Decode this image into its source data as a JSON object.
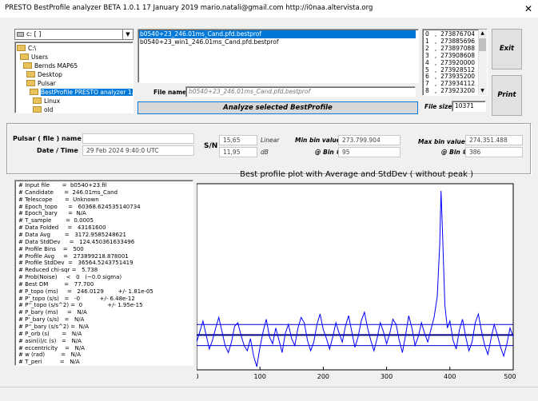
{
  "window": {
    "title": "PRESTO BestProfile analyzer BETA 1.0.1   17 January 2019       mario.natali@gmail.com      http://i0naa.altervista.org",
    "close_glyph": "✕"
  },
  "drive": {
    "value": "c: [ ]"
  },
  "dir_tree": [
    "C:\\",
    "Users",
    "Bernds MAP65",
    "Desktop",
    "Pulsar",
    "BestProfile PRESTO analyzer 1.0",
    "Linux",
    "old",
    "..."
  ],
  "dir_selected_index": 5,
  "files": [
    "b0540+23_246.01ms_Cand.pfd.bestprof",
    "b0540+23_win1_246.01ms_Cand.pfd.bestprof"
  ],
  "file_selected_index": 0,
  "file_name": {
    "label": "File name",
    "value": "b0540+23_246.01ms_Cand.pfd.bestprof"
  },
  "analyze_button": "Analyze selected BestProfile",
  "values_list": [
    "0   ,  273876704",
    "1   ,  273885696",
    "2   ,  273897088",
    "3   ,  273908608",
    "4   ,  273920000",
    "5   ,  273928512",
    "6   ,  273935200",
    "7   ,  273934112",
    "8   ,  273923200",
    "9   ,  273900192"
  ],
  "exit_button": "Exit",
  "print_button": "Print",
  "file_size": {
    "label": "File size",
    "value": "10371"
  },
  "info": {
    "pulsar_label": "Pulsar ( file ) name",
    "pulsar_value": "",
    "date_label": "Date / Time",
    "date_value": "29 Feb 2024      9:40:0  UTC",
    "sn_label": "S/N",
    "sn_linear": "15,65",
    "sn_linear_unit": "Linear",
    "sn_db": "11,95",
    "sn_db_unit": "dB",
    "min_bin_label": "Min bin value",
    "min_bin_value": "273.799.904",
    "min_bin_at_label": "@ Bin #",
    "min_bin_at": "95",
    "max_bin_label": "Max bin value",
    "max_bin_value": "274.351.488",
    "max_bin_at_label": "@ Bin #",
    "max_bin_at": "386"
  },
  "params": [
    "# Input file       =  b0540+23.fil",
    "# Candidate      =  246.01ms_Cand",
    "# Telescope       =  Unknown",
    "# Epoch_topo      =   60368.624535140734",
    "# Epoch_bary      =  N/A",
    "# T_sample        =  0.0005",
    "# Data Folded     =   43161600",
    "# Data Avg        =   3172.9585248621",
    "# Data StdDev     =   124.450361633496",
    "# Profile Bins    =   500",
    "# Profile Avg     =   273899218.878001",
    "# Profile StdDev  =   36564.5243751419",
    "# Reduced chi-sqr =   5.738",
    "# Prob(Noise)     <   0   (~0.0 sigma)",
    "# Best DM         =   77.700",
    "# P_topo (ms)     =   246.0129        +/- 1.81e-05",
    "# P'_topo (s/s)   =   -0           +/- 6.48e-12",
    "# P''_topo (s/s^2) =  0              +/- 1.95e-15",
    "# P_bary (ms)     =   N/A",
    "# P'_bary (s/s)   =   N/A",
    "# P''_bary (s/s^2) =  N/A",
    "# P_orb (s)       =   N/A",
    "# asin(i)/c (s)   =   N/A",
    "# eccentricity    =   N/A",
    "# w (rad)         =   N/A",
    "# T_peri          =   N/A"
  ],
  "colors": {
    "trace": "#0000ff",
    "band": "#0000cc",
    "selection": "#0078d7"
  },
  "chart_data": {
    "type": "line",
    "title": "Best profile plot with  Average and StdDev ( without peak )",
    "xlabel": "",
    "ylabel": "",
    "xlim": [
      0,
      500
    ],
    "ylim": [
      0,
      100
    ],
    "x_ticks": [
      "0",
      "100",
      "200",
      "300",
      "400",
      "500"
    ],
    "grid": false,
    "average": 18,
    "stddev_band": [
      12,
      24
    ],
    "peak": {
      "bin": 386,
      "level": 100
    },
    "min": {
      "bin": 95,
      "level": 0
    },
    "profile_bins": [
      0,
      5,
      10,
      15,
      20,
      25,
      30,
      35,
      40,
      45,
      50,
      55,
      60,
      65,
      70,
      75,
      80,
      85,
      90,
      95,
      100,
      105,
      110,
      115,
      120,
      125,
      130,
      135,
      140,
      145,
      150,
      155,
      160,
      165,
      170,
      175,
      180,
      185,
      190,
      195,
      200,
      205,
      210,
      215,
      220,
      225,
      230,
      235,
      240,
      245,
      250,
      255,
      260,
      265,
      270,
      275,
      280,
      285,
      290,
      295,
      300,
      305,
      310,
      315,
      320,
      325,
      330,
      335,
      340,
      345,
      350,
      355,
      360,
      365,
      370,
      375,
      380,
      384,
      386,
      388,
      392,
      396,
      400,
      405,
      410,
      415,
      420,
      425,
      430,
      435,
      440,
      445,
      450,
      455,
      460,
      465,
      470,
      475,
      480,
      485,
      490,
      495,
      500
    ],
    "profile_levels": [
      14,
      20,
      26,
      18,
      10,
      15,
      22,
      28,
      20,
      12,
      8,
      14,
      23,
      25,
      18,
      12,
      9,
      16,
      6,
      0,
      11,
      20,
      27,
      17,
      13,
      22,
      15,
      8,
      19,
      24,
      16,
      12,
      22,
      28,
      25,
      15,
      9,
      14,
      24,
      30,
      21,
      16,
      10,
      17,
      25,
      19,
      14,
      23,
      29,
      20,
      11,
      17,
      26,
      31,
      22,
      15,
      9,
      16,
      25,
      20,
      13,
      19,
      27,
      24,
      15,
      8,
      18,
      29,
      22,
      12,
      17,
      25,
      19,
      14,
      21,
      28,
      40,
      70,
      100,
      80,
      35,
      22,
      26,
      15,
      10,
      21,
      27,
      17,
      9,
      14,
      25,
      30,
      20,
      12,
      7,
      16,
      24,
      18,
      11,
      6,
      13,
      22,
      17
    ]
  }
}
